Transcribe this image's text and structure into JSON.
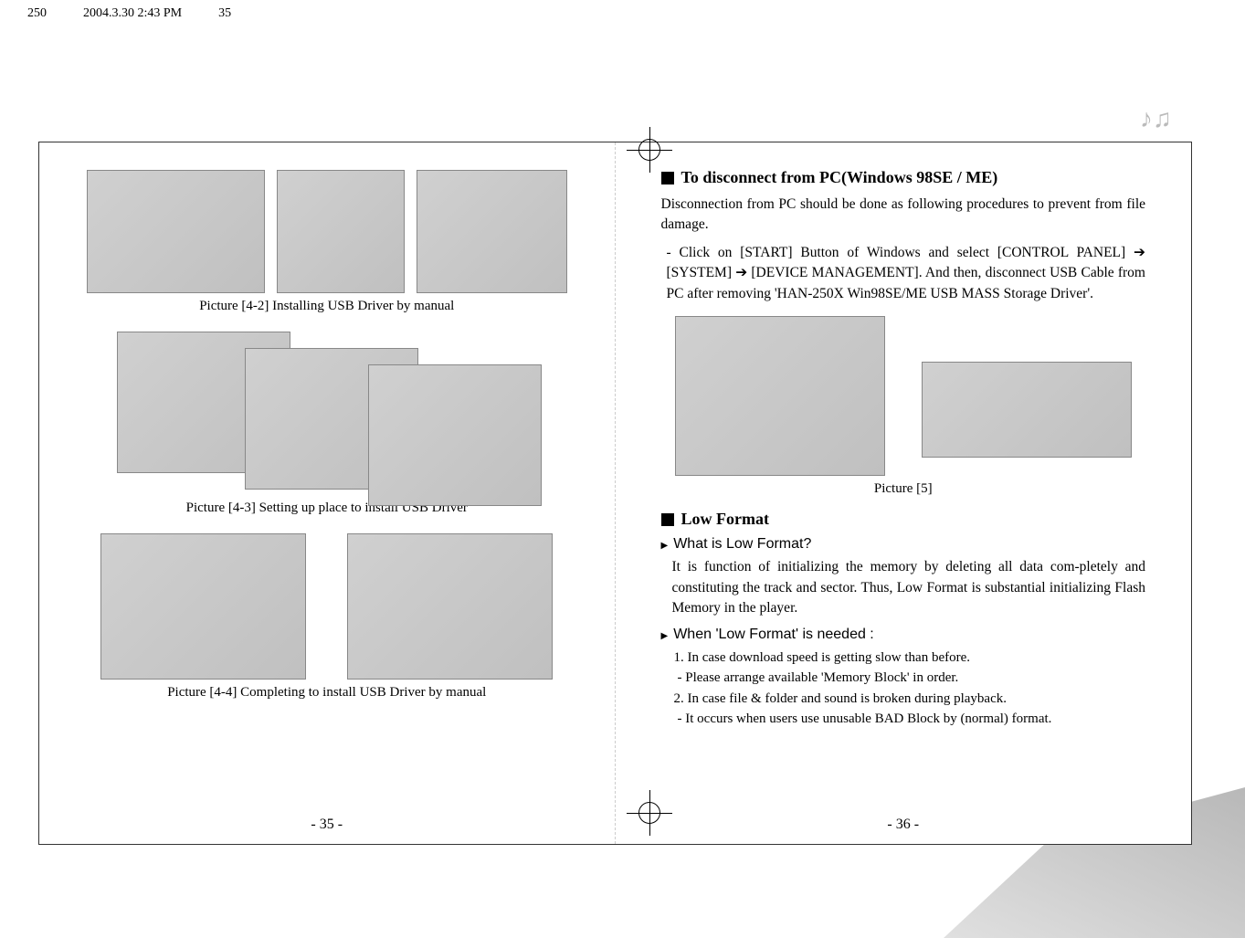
{
  "header": {
    "doc_id": "250",
    "timestamp": "2004.3.30 2:43 PM",
    "page_marker": "35"
  },
  "left_page": {
    "captions": {
      "c1": "Picture [4-2] Installing USB Driver by manual",
      "c2": "Picture [4-3] Setting up place to install USB Driver",
      "c3": "Picture [4-4] Completing to install USB Driver by manual"
    },
    "page_num": "-  35  -"
  },
  "right_page": {
    "section1": {
      "title": "To disconnect from PC(Windows 98SE / ME)",
      "p1": "Disconnection from PC should be done as following procedures to prevent from file damage.",
      "p2": "- Click on [START] Button of Windows and select [CONTROL PANEL] ➔  [SYSTEM] ➔  [DEVICE MANAGEMENT]. And then, disconnect USB Cable from PC after removing 'HAN-250X Win98SE/ME USB MASS Storage Driver'.",
      "caption": "Picture [5]"
    },
    "section2": {
      "title": "Low Format",
      "sub1": "What is Low Format?",
      "p1": "It is function of initializing the memory by deleting all data com-pletely and constituting the track and sector. Thus, Low Format is substantial initializing Flash Memory in the player.",
      "sub2": "When 'Low Format' is needed :",
      "items": {
        "i1": "1. In case download speed is getting slow than before.",
        "i2": "- Please arrange available 'Memory Block' in order.",
        "i3": "2. In case file & folder and sound is broken during playback.",
        "i4": "- It occurs when users use unusable BAD Block by (normal) format."
      }
    },
    "page_num": "-  36  -"
  },
  "music_glyph": "♪♫"
}
